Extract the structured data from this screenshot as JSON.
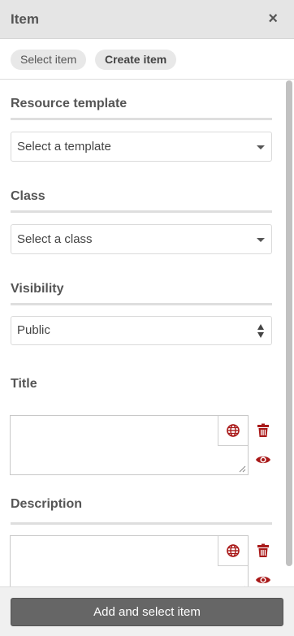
{
  "header": {
    "title": "Item",
    "close_label": "×"
  },
  "tabs": [
    {
      "label": "Select item"
    },
    {
      "label": "Create item"
    }
  ],
  "form": {
    "resource_template": {
      "label": "Resource template",
      "value": "Select a template"
    },
    "class": {
      "label": "Class",
      "value": "Select a class"
    },
    "visibility": {
      "label": "Visibility",
      "value": "Public"
    },
    "title": {
      "label": "Title",
      "value": ""
    },
    "description": {
      "label": "Description",
      "value": ""
    }
  },
  "icons": {
    "language": "globe-icon",
    "delete": "trash-icon",
    "visibility": "eye-icon"
  },
  "colors": {
    "accent": "#a91919",
    "button_bg": "#666666"
  },
  "footer": {
    "submit_label": "Add and select item"
  }
}
